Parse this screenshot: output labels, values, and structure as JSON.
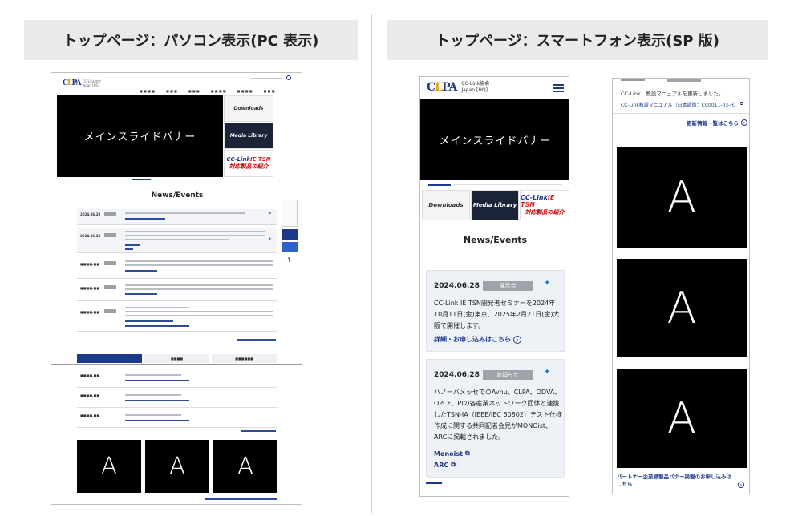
{
  "headers": {
    "pc": "トップページ：パソコン表示(PC 表示)",
    "sp": "トップページ：スマートフォン表示(SP 版)"
  },
  "banner_text": "メインスライドバナー",
  "ad_letter": "A",
  "tiles": {
    "downloads": "Downloads",
    "media_library": "Media Library",
    "cclink_title": "CC-Link",
    "cclink_highlight": "IE TSN",
    "cclink_sub": "対応製品の紹介"
  },
  "news_title": "News/Events",
  "sp_header": {
    "org_line1": "CC-Link協会",
    "org_line2": "Japan [HQ]"
  },
  "sp_cards": [
    {
      "date": "2024.06.28",
      "badge": "展示会",
      "text": "CC-Link IE TSN開発者セミナーを2024年10月11日(金)東京、2025年2月21日(金)大阪で開催します。",
      "links": [
        "詳細・お申し込みはこちら"
      ]
    },
    {
      "date": "2024.06.28",
      "badge": "お知らせ",
      "text": "ハノーバメッセでのAvnu、CLPA、ODVA、OPCF、PIの各産業ネットワーク団体と連携したTSN-IA（IEEE/IEC 60802）テスト仕様作成に関する共同記者会見がMONOist、ARCに掲載されました。",
      "links": [
        "Monoist",
        "ARC"
      ]
    }
  ],
  "sp2": {
    "update_text": "CC-Link：教設マニュアルを更新しました。",
    "manual_link": "CC-Link教設マニュアル（日本語版：CC0011-03-H）",
    "more_link": "更新情報一覧はこちら",
    "partner_link": "パートナー企業様製品バナー掲載のお申し込みはこちら"
  }
}
